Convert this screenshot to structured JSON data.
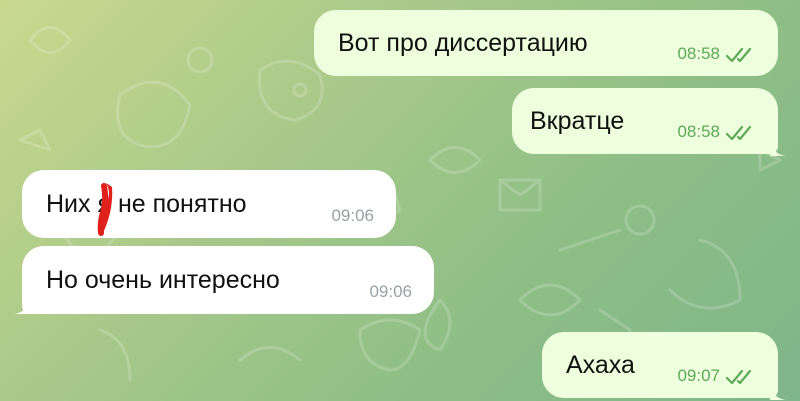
{
  "chat": {
    "messages": [
      {
        "direction": "outgoing",
        "text": "Вот про диссертацию",
        "time": "08:58",
        "read": true
      },
      {
        "direction": "outgoing",
        "text": "Вкратце",
        "time": "08:58",
        "read": true
      },
      {
        "direction": "incoming",
        "text": "Них я не понятно",
        "time": "09:06"
      },
      {
        "direction": "incoming",
        "text": "Но очень интересно",
        "time": "09:06"
      },
      {
        "direction": "outgoing",
        "text": "Ахаха",
        "time": "09:07",
        "read": true
      }
    ]
  },
  "colors": {
    "outgoing_bubble": "#eeffde",
    "incoming_bubble": "#ffffff",
    "outgoing_time": "#5fa85a",
    "incoming_time": "#9aa0a6",
    "read_checks": "#5fa85a",
    "censor_mark": "#e0201a"
  },
  "icons": {
    "read_receipt": "double-check-icon"
  }
}
